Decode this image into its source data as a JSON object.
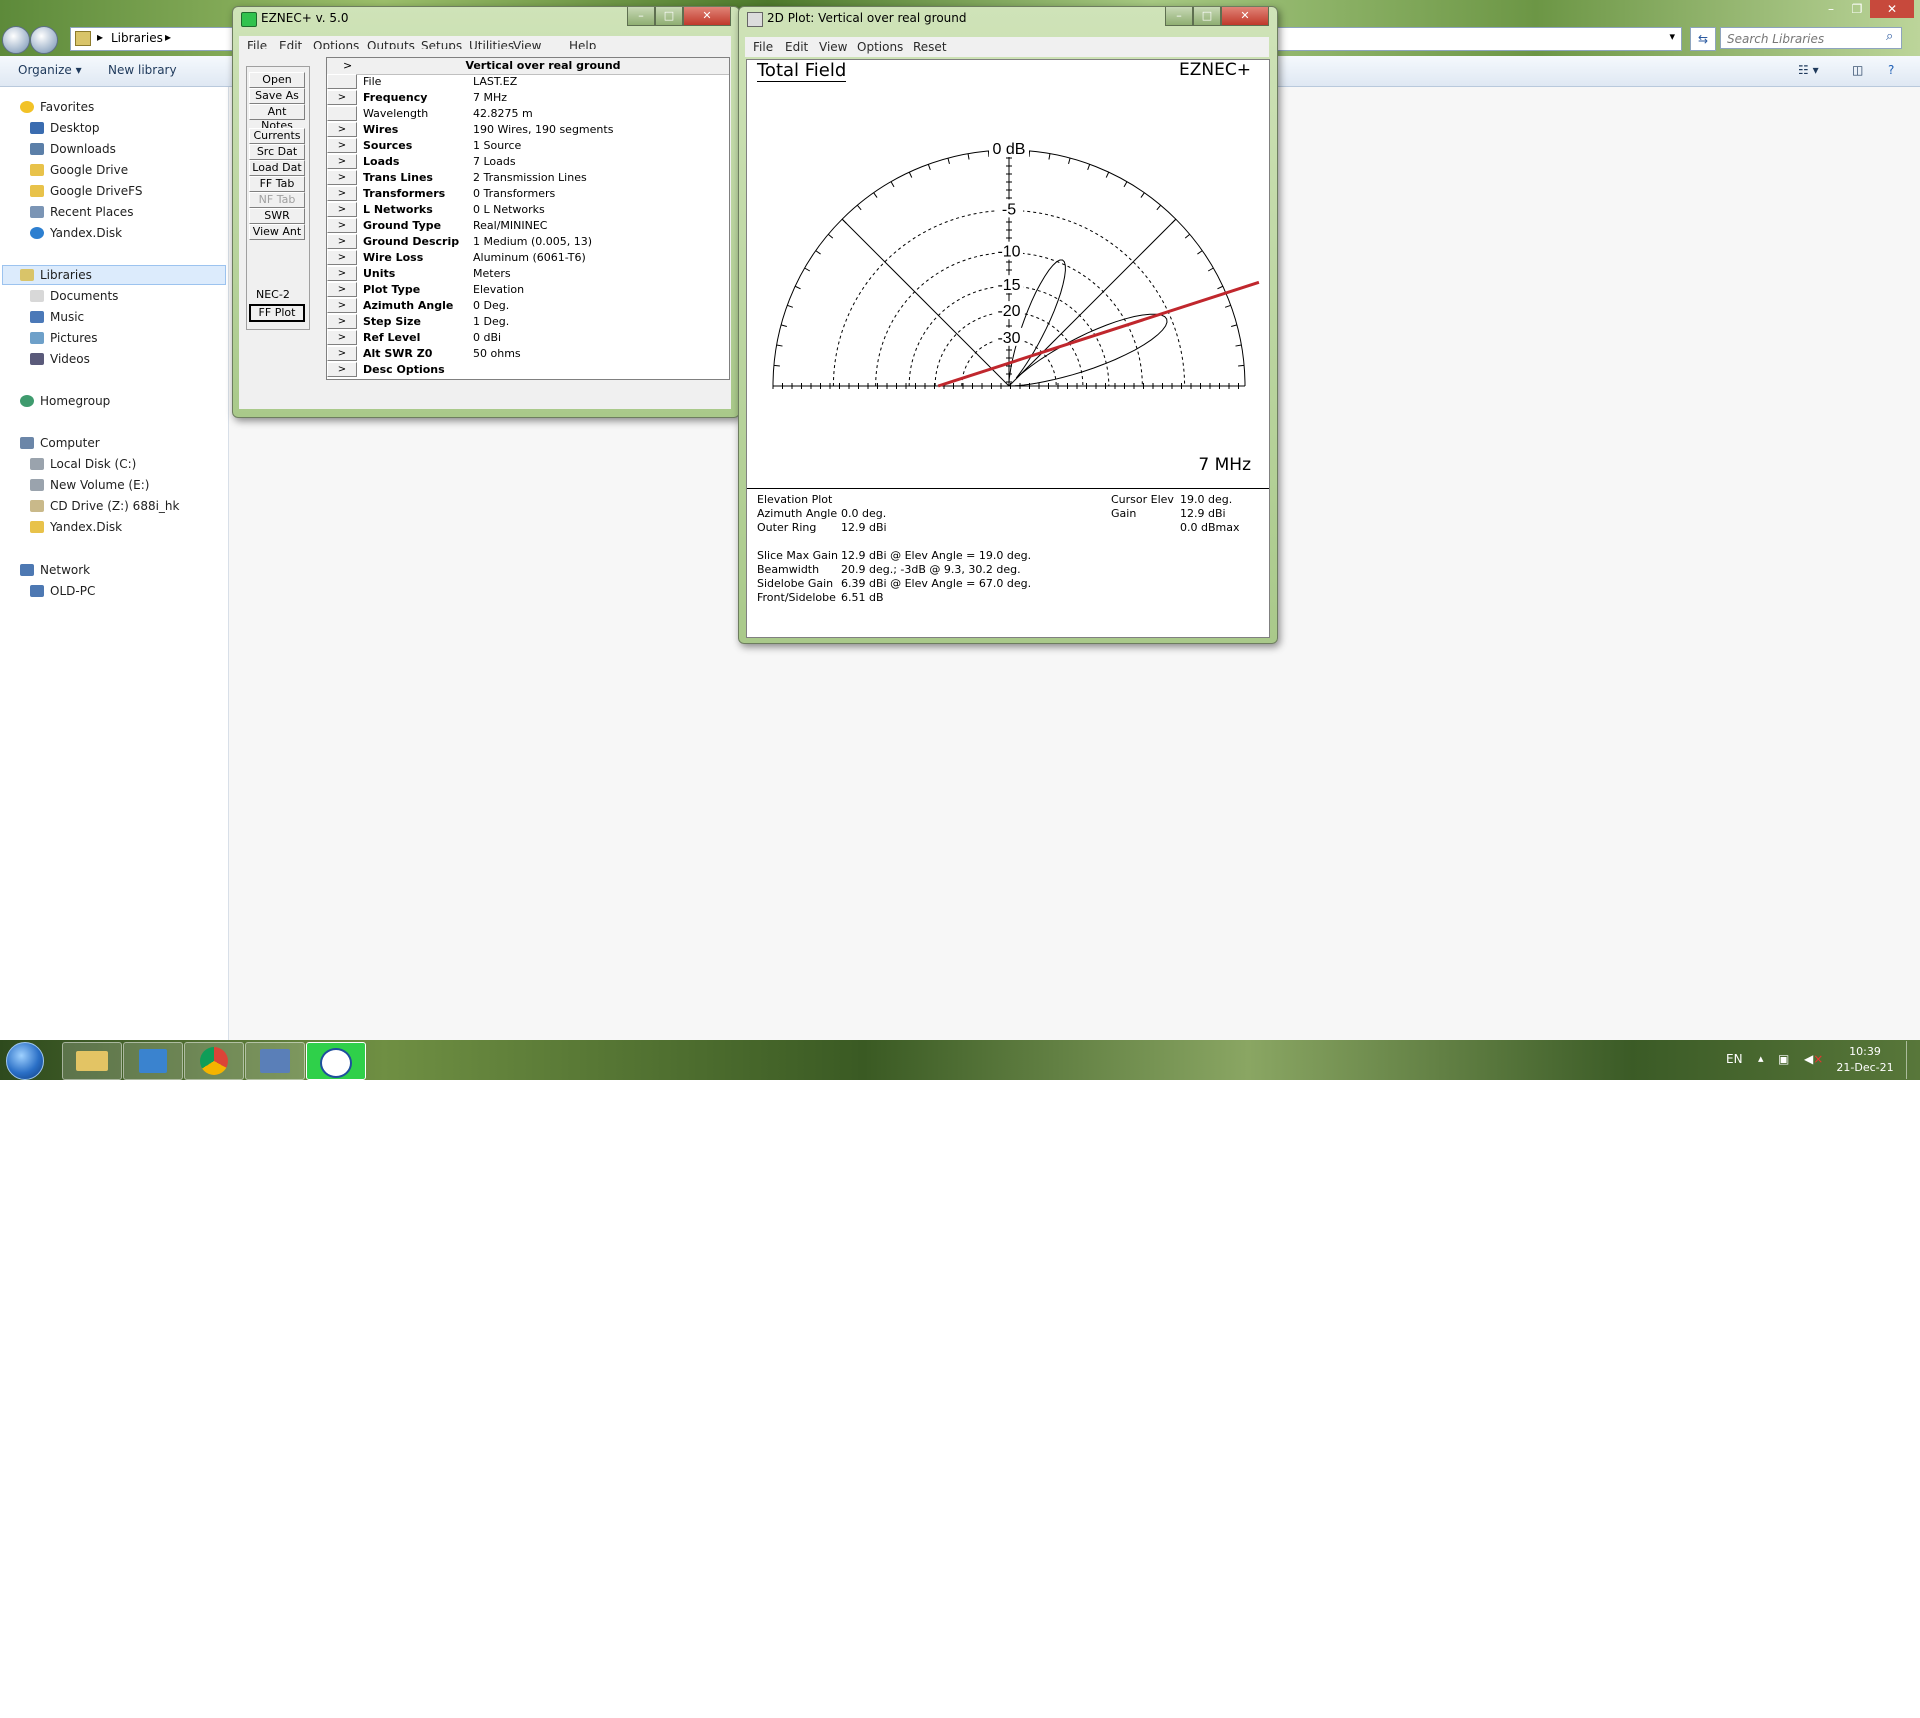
{
  "explorer": {
    "breadcrumb": [
      "Libraries"
    ],
    "search_placeholder": "Search Libraries",
    "toolbar": {
      "organize": "Organize",
      "new_library": "New library"
    },
    "nav": {
      "favorites": {
        "label": "Favorites",
        "items": [
          "Desktop",
          "Downloads",
          "Google Drive",
          "Google DriveFS",
          "Recent Places",
          "Yandex.Disk"
        ]
      },
      "libraries": {
        "label": "Libraries",
        "items": [
          "Documents",
          "Music",
          "Pictures",
          "Videos"
        ]
      },
      "homegroup": "Homegroup",
      "computer": {
        "label": "Computer",
        "items": [
          "Local Disk (C:)",
          "New Volume (E:)",
          "CD Drive (Z:) 688i_hk",
          "Yandex.Disk"
        ]
      },
      "network": {
        "label": "Network",
        "items": [
          "OLD-PC"
        ]
      }
    }
  },
  "eznec": {
    "title": "EZNEC+   v. 5.0",
    "menu": [
      "File",
      "Edit",
      "Options",
      "Outputs",
      "Setups",
      "Utilities",
      "View",
      "Help"
    ],
    "side_buttons": [
      "Open",
      "Save As",
      "Ant Notes",
      "Currents",
      "Src Dat",
      "Load Dat",
      "FF Tab",
      "NF Tab",
      "SWR",
      "View Ant"
    ],
    "engine": "NEC-2",
    "ff_plot": "FF Plot",
    "grid_header_arrow": ">",
    "grid_title": "Vertical over real ground",
    "rows": [
      {
        "arrow": "",
        "label": "File",
        "value": "LAST.EZ",
        "bold": false
      },
      {
        "arrow": ">",
        "label": "Frequency",
        "value": "7 MHz",
        "bold": true
      },
      {
        "arrow": "",
        "label": "Wavelength",
        "value": "42.8275 m",
        "bold": false
      },
      {
        "arrow": ">",
        "label": "Wires",
        "value": "190 Wires, 190 segments",
        "bold": true
      },
      {
        "arrow": ">",
        "label": "Sources",
        "value": "1 Source",
        "bold": true
      },
      {
        "arrow": ">",
        "label": "Loads",
        "value": "7 Loads",
        "bold": true
      },
      {
        "arrow": ">",
        "label": "Trans Lines",
        "value": "2 Transmission Lines",
        "bold": true
      },
      {
        "arrow": ">",
        "label": "Transformers",
        "value": "0 Transformers",
        "bold": true
      },
      {
        "arrow": ">",
        "label": "L Networks",
        "value": "0 L Networks",
        "bold": true
      },
      {
        "arrow": ">",
        "label": "Ground Type",
        "value": "Real/MININEC",
        "bold": true
      },
      {
        "arrow": ">",
        "label": "Ground Descrip",
        "value": "1 Medium (0.005, 13)",
        "bold": true
      },
      {
        "arrow": ">",
        "label": "Wire Loss",
        "value": "Aluminum (6061-T6)",
        "bold": true
      },
      {
        "arrow": ">",
        "label": "Units",
        "value": "Meters",
        "bold": true
      },
      {
        "arrow": ">",
        "label": "Plot Type",
        "value": "Elevation",
        "bold": true
      },
      {
        "arrow": ">",
        "label": "Azimuth Angle",
        "value": "0 Deg.",
        "bold": true
      },
      {
        "arrow": ">",
        "label": "Step Size",
        "value": "1 Deg.",
        "bold": true
      },
      {
        "arrow": ">",
        "label": "Ref Level",
        "value": "0 dBi",
        "bold": true
      },
      {
        "arrow": ">",
        "label": "Alt SWR Z0",
        "value": "50 ohms",
        "bold": true
      },
      {
        "arrow": ">",
        "label": "Desc Options",
        "value": "",
        "bold": true
      }
    ]
  },
  "plot": {
    "title": "2D Plot: Vertical over real ground",
    "menu": [
      "File",
      "Edit",
      "View",
      "Options",
      "Reset"
    ],
    "heading": "Total Field",
    "brand": "EZNEC+",
    "freq": "7 MHz",
    "rings": [
      "0 dB",
      "-5",
      "-10",
      "-15",
      "-20",
      "-30"
    ],
    "info_left": [
      {
        "label": "Elevation Plot",
        "value": ""
      },
      {
        "label": "Azimuth Angle",
        "value": "0.0 deg."
      },
      {
        "label": "Outer Ring",
        "value": "12.9 dBi"
      }
    ],
    "info_right": [
      {
        "label": "Cursor Elev",
        "value": "19.0 deg."
      },
      {
        "label": "Gain",
        "value": "12.9 dBi"
      },
      {
        "label": "",
        "value": "0.0 dBmax"
      }
    ],
    "info_bottom": [
      {
        "label": "Slice Max Gain",
        "value": "12.9 dBi @ Elev Angle = 19.0 deg."
      },
      {
        "label": "Beamwidth",
        "value": "20.9 deg.; -3dB @ 9.3, 30.2 deg."
      },
      {
        "label": "Sidelobe Gain",
        "value": "6.39 dBi @ Elev Angle = 67.0 deg."
      },
      {
        "label": "Front/Sidelobe",
        "value": "6.51 dB"
      }
    ]
  },
  "taskbar": {
    "lang": "EN",
    "time": "10:39",
    "date": "21-Dec-21"
  },
  "colors": {
    "cursor_line": "#c0272d",
    "taskbar_active": "#2fd04a"
  }
}
